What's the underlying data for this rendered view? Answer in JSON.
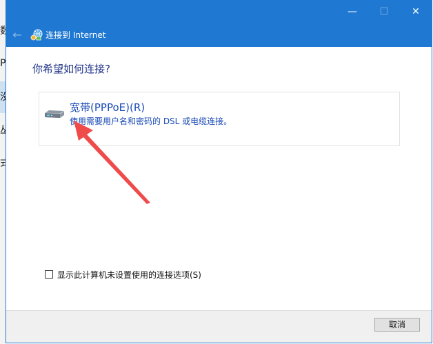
{
  "window": {
    "minimize_glyph": "—",
    "maximize_glyph": "☐",
    "close_glyph": "✕"
  },
  "nav": {
    "back_glyph": "←",
    "title": "连接到 Internet"
  },
  "main": {
    "heading": "你希望如何连接?",
    "option": {
      "title": "宽带(PPPoE)(R)",
      "description": "使用需要用户名和密码的 DSL 或电缆连接。",
      "icon": "broadband-modem-icon"
    },
    "checkbox": {
      "label": "显示此计算机未设置使用的连接选项(S)",
      "checked": false
    }
  },
  "footer": {
    "cancel_label": "取消"
  },
  "colors": {
    "titlebar": "#1f78d1",
    "heading": "#1e3287",
    "link_text": "#1a4bb6",
    "annotation_arrow": "#ef4b4b"
  },
  "background_window": {
    "fragments": [
      "数",
      "P",
      "没",
      "丛",
      "式"
    ]
  }
}
